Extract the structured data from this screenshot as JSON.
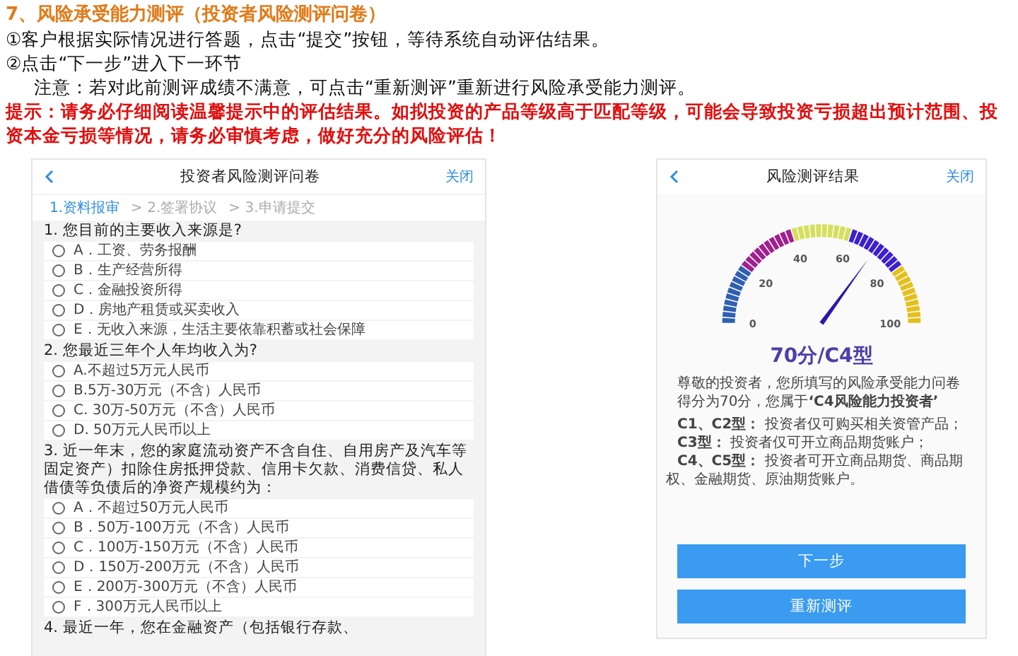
{
  "doc": {
    "heading": "7、风险承受能力测评（投资者风险测评问卷）",
    "steps": [
      "①客户根据实际情况进行答题，点击“提交”按钮，等待系统自动评估结果。",
      "②点击“下一步”进入下一环节"
    ],
    "note": "注意：若对此前测评成绩不满意，可点击“重新测评”重新进行风险承受能力测评。",
    "warning": "提示：请务必仔细阅读温馨提示中的评估结果。如拟投资的产品等级高于匹配等级，可能会导致投资亏损超出预计范围、投资本金亏损等情况，请务必审慎考虑，做好充分的风险评估！"
  },
  "questionnaire": {
    "title": "投资者风险测评问卷",
    "close": "关闭",
    "progress": [
      {
        "label": "1.资料报审",
        "selected": true
      },
      {
        "label": "> 2.签署协议",
        "selected": false
      },
      {
        "label": "> 3.申请提交",
        "selected": false
      }
    ],
    "questions": [
      {
        "text": "1. 您目前的主要收入来源是?",
        "options": [
          {
            "label": "A．工资、劳务报酬",
            "selected": false
          },
          {
            "label": "B．生产经营所得",
            "selected": false
          },
          {
            "label": "C．金融投资所得",
            "selected": false
          },
          {
            "label": "D．房地产租赁或买卖收入",
            "selected": false
          },
          {
            "label": "E．无收入来源，生活主要依靠积蓄或社会保障",
            "selected": false
          }
        ]
      },
      {
        "text": "2. 您最近三年个人年均收入为?",
        "options": [
          {
            "label": "A.不超过5万元人民币",
            "selected": false
          },
          {
            "label": "B.5万-30万元（不含）人民币",
            "selected": false
          },
          {
            "label": "C. 30万-50万元（不含）人民币",
            "selected": false
          },
          {
            "label": "D. 50万元人民币以上",
            "selected": false
          }
        ]
      },
      {
        "text": "3. 近一年末，您的家庭流动资产不含自住、自用房产及汽车等固定资产）扣除住房抵押贷款、信用卡欠款、消费信贷、私人借债等负债后的净资产规模约为：",
        "options": [
          {
            "label": "A．不超过50万元人民币",
            "selected": false
          },
          {
            "label": "B．50万-100万元（不含）人民币",
            "selected": false
          },
          {
            "label": "C．100万-150万元（不含）人民币",
            "selected": false
          },
          {
            "label": "D．150万-200万元（不含）人民币",
            "selected": false
          },
          {
            "label": "E．200万-300万元（不含）人民币",
            "selected": false
          },
          {
            "label": "F．300万元人民币以上",
            "selected": false
          }
        ]
      },
      {
        "text": "4. 最近一年，您在金融资产（包括银行存款、"
      }
    ]
  },
  "result": {
    "title": "风险测评结果",
    "close": "关闭",
    "gauge": {
      "tick_labels": [
        "0",
        "20",
        "40",
        "60",
        "80",
        "100"
      ]
    },
    "score": "70分/C4型",
    "message": "尊敬的投资者，您所填写的风险承受能力问卷得分为70分，您属于**‘C4风险能力投资者’**",
    "types": [
      "**C1、C2型：**  投资者仅可购买相关资管产品；",
      "**C3型：**  投资者仅可开立商品期货账户；",
      "**C4、C5型：**  投资者可开立商品期货、商品期权、金融期货、原油期货账户。"
    ],
    "buttons": [
      "下一步",
      "重新测评"
    ]
  }
}
